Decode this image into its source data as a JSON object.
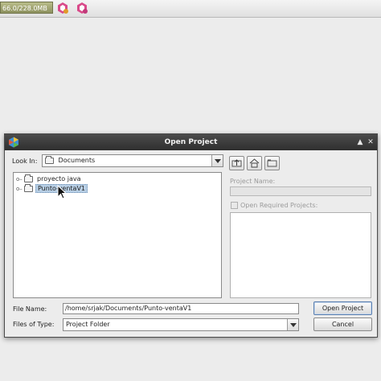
{
  "toolbar": {
    "memory_label": "66.0/228.0MB",
    "icons": [
      "gc-icon",
      "profile-icon"
    ]
  },
  "dialog": {
    "title": "Open Project",
    "look_in_label": "Look In:",
    "look_in_value": "Documents",
    "tree_items": [
      {
        "label": "proyecto java",
        "selected": false
      },
      {
        "label": "Punto-ventaV1",
        "selected": true
      }
    ],
    "project_name_label": "Project Name:",
    "project_name_value": "",
    "open_required_label": "Open Required Projects:",
    "file_name_label": "File Name:",
    "file_name_value": "/home/srjak/Documents/Punto-ventaV1",
    "files_of_type_label": "Files of Type:",
    "files_of_type_value": "Project Folder",
    "open_button": "Open Project",
    "cancel_button": "Cancel"
  },
  "colors": {
    "titlebar": "#3a3a3a",
    "selection": "#b8cfe5",
    "memory_bar": "#9fa372"
  }
}
